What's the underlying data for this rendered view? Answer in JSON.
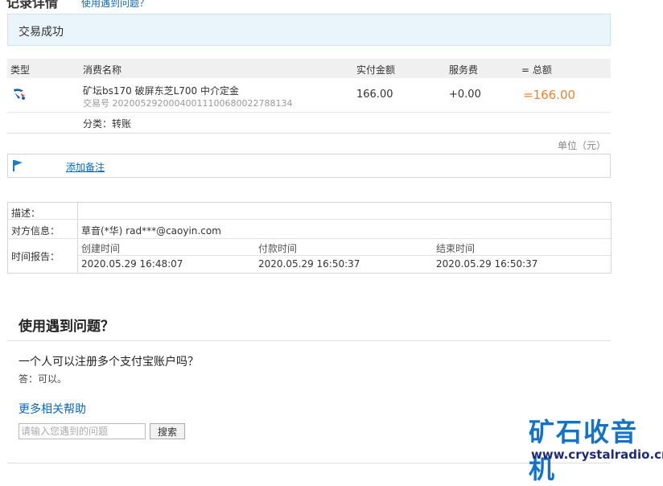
{
  "header": {
    "title": "记录详情",
    "help_link": "使用遇到问题？"
  },
  "status": {
    "text": "交易成功"
  },
  "table": {
    "columns": [
      "类型",
      "消费名称",
      "实付金额",
      "服务费",
      "= 总额"
    ],
    "row": {
      "type_icon": "transfer-icon",
      "name": "矿坛bs170 破屏东芝L700 中介定金",
      "tx_no_label": "交易号",
      "tx_no": "20200529200040011100680022788134",
      "paid": "166.00",
      "fee": "+0.00",
      "total": "=166.00"
    },
    "category": "分类：转账",
    "unit": "单位（元）"
  },
  "note": {
    "label": "添加备注",
    "icon": "flag-icon"
  },
  "details": {
    "desc_label": "描述：",
    "desc_value": "",
    "party_label": "对方信息：",
    "party_value": "草音(*华) rad***@caoyin.com",
    "time_label": "时间报告：",
    "time_headers": [
      "创建时间",
      "付款时间",
      "结束时间"
    ],
    "time_values": [
      "2020.05.29 16:48:07",
      "2020.05.29 16:50:37",
      "2020.05.29 16:50:37"
    ]
  },
  "help": {
    "title": "使用遇到问题？",
    "question": "一个人可以注册多个支付宝账户吗？",
    "answer": "答：可以。",
    "more": "更多相关帮助",
    "search_placeholder": "请输入您遇到的问题",
    "search_button": "搜索"
  },
  "watermark": {
    "logo": "矿石收音机",
    "url": "www.crystalradio.cn"
  },
  "colors": {
    "link": "#0a69b8",
    "total": "#f4812a",
    "status_bg": "#e9f4fb",
    "watermark": "#1273c8"
  }
}
